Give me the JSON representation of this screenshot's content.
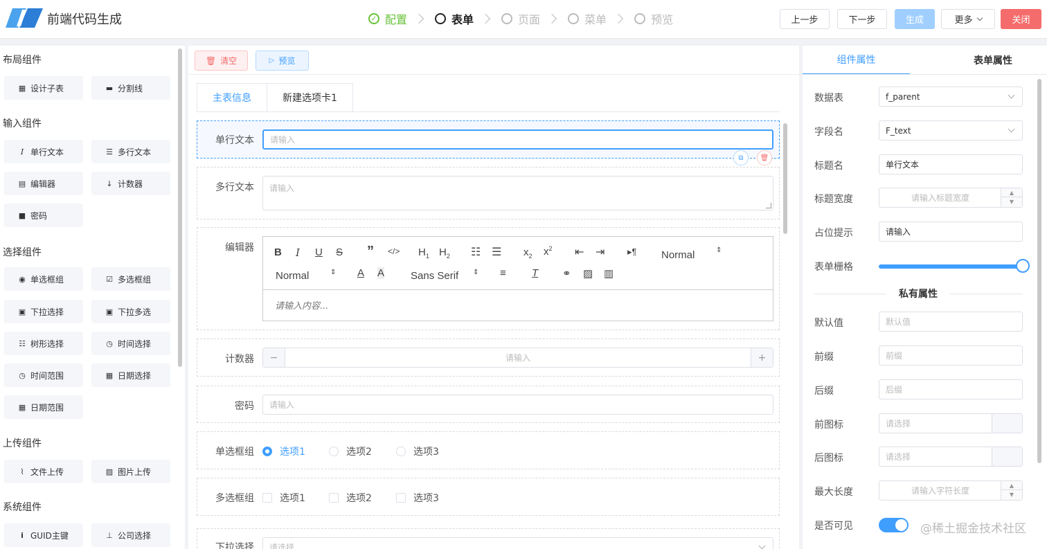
{
  "header": {
    "app_title": "前端代码生成",
    "steps": [
      {
        "label": "配置",
        "state": "done"
      },
      {
        "label": "表单",
        "state": "active"
      },
      {
        "label": "页面",
        "state": "todo"
      },
      {
        "label": "菜单",
        "state": "todo"
      },
      {
        "label": "预览",
        "state": "todo"
      }
    ],
    "buttons": {
      "prev": "上一步",
      "next": "下一步",
      "generate": "生成",
      "more": "更多",
      "close": "关闭"
    },
    "colors": {
      "done": "#67c23a",
      "primary": "#409eff",
      "danger": "#f56c6c"
    }
  },
  "left": {
    "categories": [
      "布局组件",
      "输入组件",
      "选择组件",
      "上传组件",
      "系统组件"
    ],
    "layout": [
      {
        "label": "设计子表",
        "icon": "table-icon"
      },
      {
        "label": "分割线",
        "icon": "divider-icon"
      }
    ],
    "input": [
      {
        "label": "单行文本",
        "icon": "italic-i-icon"
      },
      {
        "label": "多行文本",
        "icon": "lines-icon"
      },
      {
        "label": "编辑器",
        "icon": "document-icon"
      },
      {
        "label": "计数器",
        "icon": "sort-numeric-icon"
      },
      {
        "label": "密码",
        "icon": "lock-icon"
      }
    ],
    "select": [
      {
        "label": "单选框组",
        "icon": "radio-icon"
      },
      {
        "label": "多选框组",
        "icon": "checkbox-icon"
      },
      {
        "label": "下拉选择",
        "icon": "dropdown-icon"
      },
      {
        "label": "下拉多选",
        "icon": "dropdown-icon"
      },
      {
        "label": "树形选择",
        "icon": "list-icon"
      },
      {
        "label": "时间选择",
        "icon": "clock-icon"
      },
      {
        "label": "时间范围",
        "icon": "clock-icon"
      },
      {
        "label": "日期选择",
        "icon": "calendar-icon"
      },
      {
        "label": "日期范围",
        "icon": "calendar-icon"
      }
    ],
    "upload": [
      {
        "label": "文件上传",
        "icon": "paperclip-icon"
      },
      {
        "label": "图片上传",
        "icon": "image-icon"
      }
    ],
    "system": [
      {
        "label": "GUID主键",
        "icon": "info-icon"
      },
      {
        "label": "公司选择",
        "icon": "org-chart-icon"
      }
    ]
  },
  "center": {
    "toolbar": {
      "clear": "清空",
      "preview": "预览"
    },
    "tabs": [
      "主表信息",
      "新建选项卡1"
    ],
    "fields": {
      "text": {
        "label": "单行文本",
        "placeholder": "请输入"
      },
      "textarea": {
        "label": "多行文本",
        "placeholder": "请输入"
      },
      "editor": {
        "label": "编辑器",
        "placeholder": "请输入内容...",
        "header": "Normal",
        "size": "Normal",
        "font": "Sans Serif"
      },
      "counter": {
        "label": "计数器",
        "placeholder": "请输入",
        "minus": "−",
        "plus": "+"
      },
      "password": {
        "label": "密码",
        "placeholder": "请输入"
      },
      "radio": {
        "label": "单选框组",
        "options": [
          "选项1",
          "选项2",
          "选项3"
        ],
        "selected": "选项1"
      },
      "checkbox": {
        "label": "多选框组",
        "options": [
          "选项1",
          "选项2",
          "选项3"
        ]
      },
      "dropdown": {
        "label": "下拉选择",
        "placeholder": "请选择"
      }
    }
  },
  "right": {
    "tabs": [
      "组件属性",
      "表单属性"
    ],
    "props": {
      "table": {
        "label": "数据表",
        "value": "f_parent"
      },
      "field": {
        "label": "字段名",
        "value": "F_text"
      },
      "title": {
        "label": "标题名",
        "value": "单行文本"
      },
      "title_width": {
        "label": "标题宽度",
        "placeholder": "请输入标题宽度"
      },
      "placeholder": {
        "label": "占位提示",
        "value": "请输入"
      },
      "grid": {
        "label": "表单栅格",
        "value": 24,
        "max": 24
      },
      "private_title": "私有属性",
      "default": {
        "label": "默认值",
        "placeholder": "默认值"
      },
      "prefix": {
        "label": "前缀",
        "placeholder": "前缀"
      },
      "suffix": {
        "label": "后缀",
        "placeholder": "后缀"
      },
      "prefix_icon": {
        "label": "前图标",
        "placeholder": "请选择"
      },
      "suffix_icon": {
        "label": "后图标",
        "placeholder": "请选择"
      },
      "max_length": {
        "label": "最大长度",
        "placeholder": "请输入字符长度"
      },
      "visible": {
        "label": "是否可见",
        "value": true
      }
    },
    "watermark": "@稀土掘金技术社区"
  }
}
